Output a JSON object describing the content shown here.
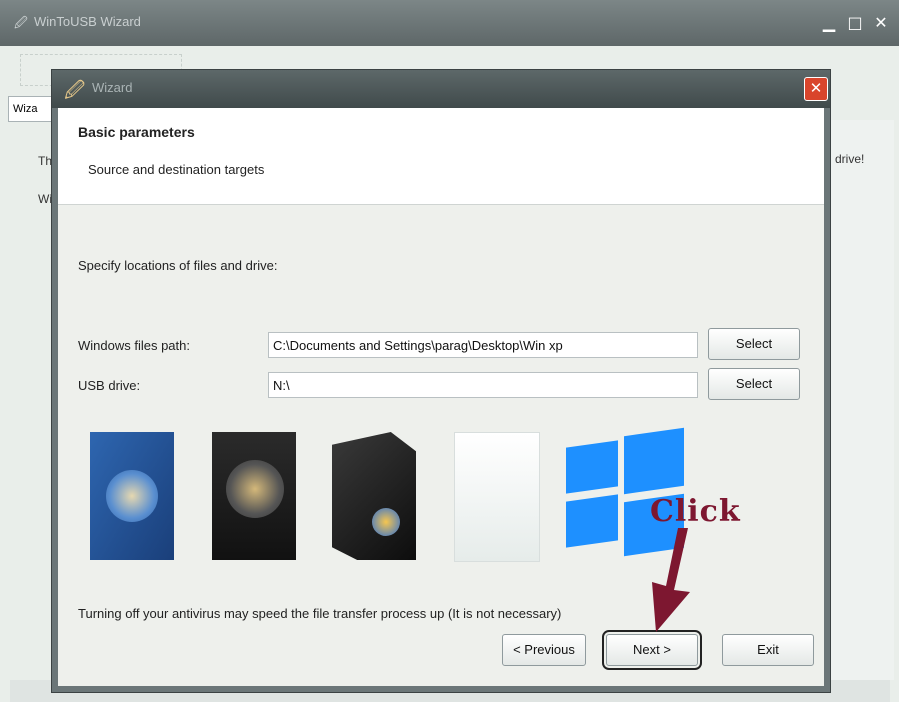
{
  "app": {
    "title": "WinToUSB Wizard",
    "tab_label": "Wiza",
    "side_text_1": "Th",
    "side_text_2": "Wi",
    "side_text_right": "drive!",
    "controls": [
      "minimize-icon",
      "maximize-icon",
      "close-icon"
    ]
  },
  "dialog": {
    "title": "Wizard",
    "header_title": "Basic parameters",
    "header_subtitle": "Source and destination targets",
    "instructions": "Specify locations of files and drive:",
    "windows_path_label": "Windows files path:",
    "windows_path_value": "C:\\Documents and Settings\\parag\\Desktop\\Win xp",
    "usb_label": "USB drive:",
    "usb_value": "N:\\",
    "select_label": "Select",
    "note": "Turning off your antivirus may speed the file transfer process up (It is not necessary)",
    "buttons": {
      "previous": "< Previous",
      "next": "Next >",
      "exit": "Exit"
    }
  },
  "annotation": {
    "click_text": "Click",
    "color": "#7d1730"
  },
  "colors": {
    "windows_blue": "#1e90ff",
    "close_red": "#d9452c"
  }
}
